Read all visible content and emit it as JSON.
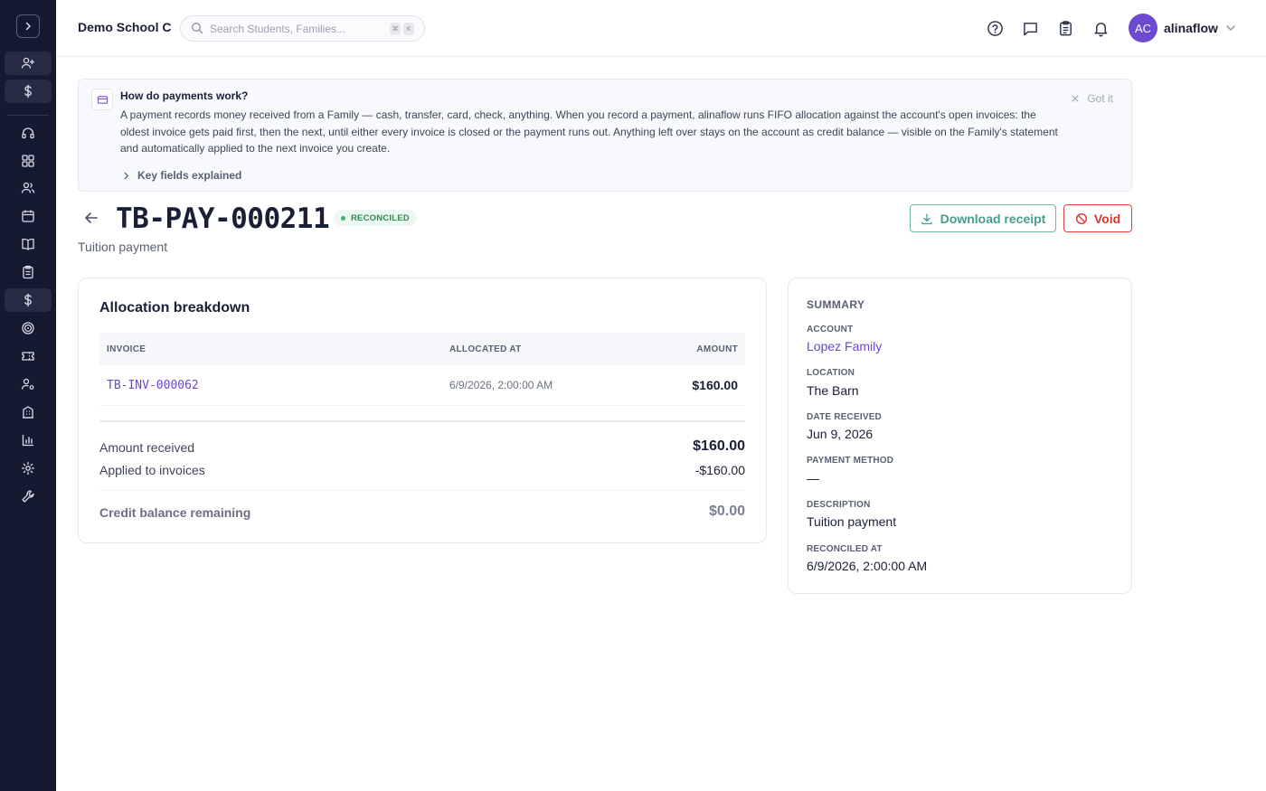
{
  "topbar": {
    "school_name": "Demo School C",
    "search_placeholder": "Search Students, Families...",
    "search_shortcut": [
      "⌘",
      "K"
    ],
    "avatar_initials": "AC",
    "username": "alinaflow"
  },
  "sidebar": {
    "items": [
      "expand-sidebar",
      "add-user",
      "billing",
      "support",
      "dashboard",
      "people",
      "calendar",
      "library",
      "clipboard",
      "payments",
      "goals",
      "tickets",
      "user-settings",
      "building",
      "reports",
      "settings",
      "tools"
    ]
  },
  "info_banner": {
    "title": "How do payments work?",
    "body": "A payment records money received from a Family — cash, transfer, card, check, anything. When you record a payment, alinaflow runs FIFO allocation against the account's open invoices: the oldest invoice gets paid first, then the next, until either every invoice is closed or the payment runs out. Anything left over stays on the account as credit balance — visible on the Family's statement and automatically applied to the next invoice you create.",
    "dismiss_label": "Got it",
    "key_fields_label": "Key fields explained"
  },
  "header": {
    "title": "TB-PAY-000211",
    "status": "RECONCILED",
    "subtitle": "Tuition payment",
    "download_label": "Download receipt",
    "void_label": "Void"
  },
  "allocation": {
    "title": "Allocation breakdown",
    "columns": [
      "INVOICE",
      "ALLOCATED AT",
      "AMOUNT"
    ],
    "rows": [
      {
        "invoice": "TB-INV-000062",
        "allocated_at": "6/9/2026, 2:00:00 AM",
        "amount": "$160.00"
      }
    ],
    "amount_received_label": "Amount received",
    "amount_received": "$160.00",
    "applied_label": "Applied to invoices",
    "applied": "-$160.00",
    "credit_label": "Credit balance remaining",
    "credit": "$0.00"
  },
  "summary": {
    "title": "SUMMARY",
    "account_label": "ACCOUNT",
    "account": "Lopez Family",
    "location_label": "LOCATION",
    "location": "The Barn",
    "date_label": "DATE RECEIVED",
    "date": "Jun 9, 2026",
    "method_label": "PAYMENT METHOD",
    "method": "—",
    "description_label": "DESCRIPTION",
    "description": "Tuition payment",
    "reconciled_label": "RECONCILED AT",
    "reconciled": "6/9/2026, 2:00:00 AM"
  },
  "colors": {
    "sidebar_bg": "#161a30",
    "accent_purple": "#6a48c7",
    "status_green": "#2f8a56",
    "download_teal": "#4a9b90",
    "void_red": "#d43a31"
  }
}
